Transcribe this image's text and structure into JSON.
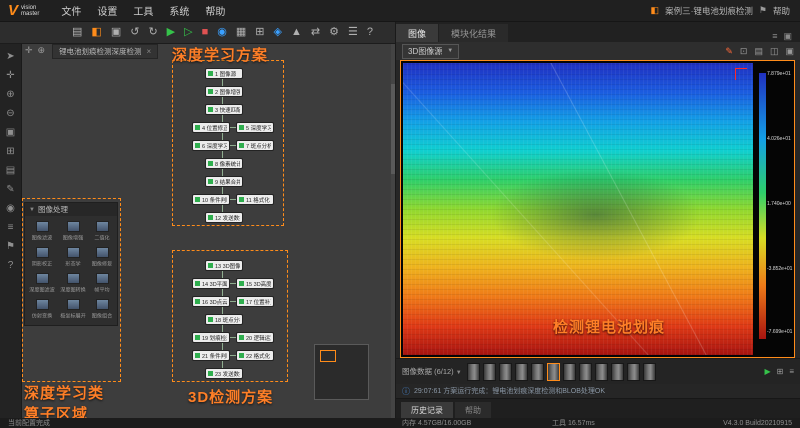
{
  "colors": {
    "accent_orange": "#ff8c1a",
    "annotation_orange": "#ff7f27",
    "node_green": "#2fae4e",
    "info_blue": "#4a90e2"
  },
  "titlebar": {
    "logo_v": "V",
    "logo_line1": "vision",
    "logo_line2": "master",
    "menus": [
      "文件",
      "设置",
      "工具",
      "系统",
      "帮助"
    ],
    "project": "案例三·锂电池划痕检测",
    "help_label": "帮助"
  },
  "toolbar": {
    "icons": [
      {
        "name": "new-file",
        "glyph": "▤"
      },
      {
        "name": "open-folder",
        "glyph": "◧"
      },
      {
        "name": "save",
        "glyph": "▣"
      },
      {
        "name": "undo",
        "glyph": "↺"
      },
      {
        "name": "redo",
        "glyph": "↻"
      },
      {
        "name": "run",
        "glyph": "▶"
      },
      {
        "name": "run-once",
        "glyph": "▷"
      },
      {
        "name": "stop",
        "glyph": "■"
      },
      {
        "name": "camera",
        "glyph": "◉"
      },
      {
        "name": "image",
        "glyph": "▦"
      },
      {
        "name": "module",
        "glyph": "⊞"
      },
      {
        "name": "3d-view",
        "glyph": "◈"
      },
      {
        "name": "chart",
        "glyph": "▲"
      },
      {
        "name": "io",
        "glyph": "⇄"
      },
      {
        "name": "settings",
        "glyph": "⚙"
      },
      {
        "name": "layout",
        "glyph": "☰"
      },
      {
        "name": "help",
        "glyph": "?"
      }
    ]
  },
  "left_toolbar": {
    "icons": [
      {
        "name": "select",
        "glyph": "➤"
      },
      {
        "name": "pan",
        "glyph": "✛"
      },
      {
        "name": "zoom-in",
        "glyph": "⊕"
      },
      {
        "name": "zoom-out",
        "glyph": "⊖"
      },
      {
        "name": "fit-view",
        "glyph": "▣"
      },
      {
        "name": "grid",
        "glyph": "⊞"
      },
      {
        "name": "layers",
        "glyph": "▤"
      },
      {
        "name": "edit",
        "glyph": "✎"
      },
      {
        "name": "target",
        "glyph": "◉"
      },
      {
        "name": "list",
        "glyph": "≡"
      },
      {
        "name": "flag",
        "glyph": "⚑"
      },
      {
        "name": "help",
        "glyph": "?"
      }
    ]
  },
  "canvas": {
    "tab": "锂电池划痕检测深度检测",
    "close_label": "×",
    "tool_icons": [
      {
        "name": "pan",
        "glyph": "✛"
      },
      {
        "name": "zoom",
        "glyph": "⊕"
      }
    ],
    "annotations": {
      "top": "深度学习方案",
      "bottom": "3D检测方案",
      "left_line1": "深度学习类",
      "left_line2": "算子区域"
    },
    "flow": {
      "top": [
        "1 图像源",
        "2 图像增强",
        "3 快速匹配",
        "4 位置修正",
        "5 深度学习训练",
        "6 深度学习分割",
        "7 斑点分析",
        "8 像素统计",
        "9 结果合并",
        "10 条件判断",
        "11 格式化",
        "12 发送数据"
      ],
      "bottom": [
        "13 3D图像源",
        "14 3D平面拟合",
        "15 3D高度测量",
        "16 3D点云裁剪",
        "17 位置补正",
        "18 斑点分析",
        "19 划痕检测",
        "20 逻辑运算",
        "21 条件判断",
        "22 格式化",
        "23 发送数据"
      ]
    },
    "operator_panel": {
      "title": "图像处理",
      "items": [
        {
          "label": "图像滤波"
        },
        {
          "label": "图像增强"
        },
        {
          "label": "二值化"
        },
        {
          "label": "阴影校正"
        },
        {
          "label": "形态学"
        },
        {
          "label": "图像修复"
        },
        {
          "label": "深度图滤波"
        },
        {
          "label": "深度图转换"
        },
        {
          "label": "帧平均"
        },
        {
          "label": "仿射变换"
        },
        {
          "label": "极坐标展开"
        },
        {
          "label": "图像组合"
        }
      ]
    }
  },
  "right": {
    "tabs": [
      "图像",
      "模块化结果"
    ],
    "source_select": "3D图像源",
    "viewer_icons": [
      {
        "name": "edit",
        "glyph": "✎"
      },
      {
        "name": "fit",
        "glyph": "⊡"
      },
      {
        "name": "layers",
        "glyph": "▤"
      },
      {
        "name": "compare",
        "glyph": "◫"
      },
      {
        "name": "fullscreen",
        "glyph": "▣"
      }
    ],
    "scale_labels": [
      "7.879e+01",
      "4.026e+01",
      "1.740e+00",
      "-3.852e+01",
      "-7.699e+01"
    ],
    "overlay": "检测锂电池划痕",
    "strip": {
      "label": "图像数据 (6/12)",
      "controls": [
        {
          "name": "play",
          "glyph": "▶"
        },
        {
          "name": "grid-view",
          "glyph": "⊞"
        },
        {
          "name": "list-view",
          "glyph": "≡"
        }
      ]
    },
    "message": "29:07:61 方案运行完成：锂电池划痕深度检测和BLOB处理OK",
    "history_tabs": [
      "历史记录",
      "帮助"
    ]
  },
  "statusbar": {
    "left": "当前配置完成",
    "memory": "内存 4.57GB/16.00GB",
    "tool_time": "工具 16.57ms",
    "version": "V4.3.0 Build20210915"
  }
}
